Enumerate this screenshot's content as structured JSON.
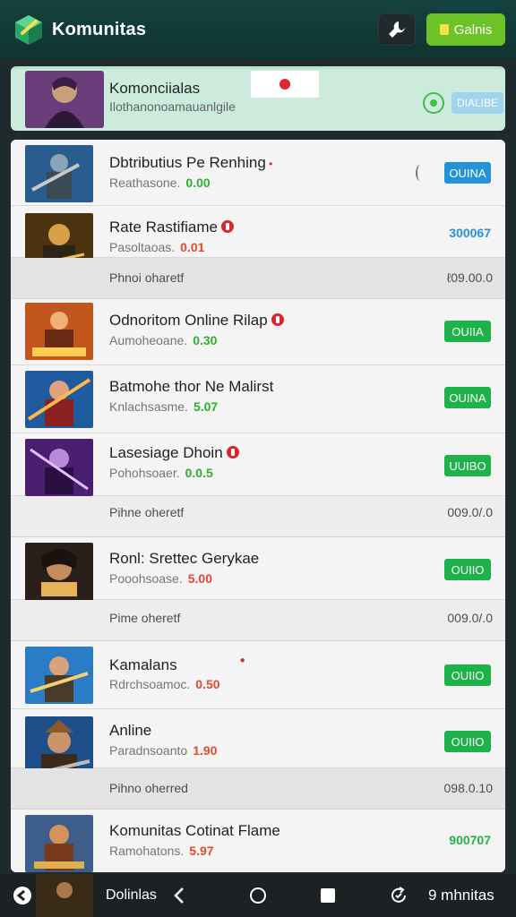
{
  "header": {
    "title": "Komunitas",
    "action_label": "Galnis",
    "logo_icon": "cube-logo-icon",
    "tool_icon": "wrench-icon"
  },
  "featured": {
    "title": "Komonciialas",
    "subtitle": "Ilothanonoamauanlgile",
    "tag_label": "DIALIBE"
  },
  "rows": [
    {
      "title": "Dbtributius Pe Renhing",
      "sub_label": "Reathasone.",
      "sub_value": "0.00",
      "sub_color": "#2fae2f",
      "action": "OUINA",
      "action_style": "blue"
    },
    {
      "title": "Rate Rastifiame",
      "sub_label": "Pasoltaoas.",
      "sub_value": "0.01",
      "sub_color": "#e24b2d",
      "action_text": "300067",
      "action_color": "#2592d8"
    },
    {
      "title": "Odnoritom Online Rilap",
      "sub_label": "Aumoheoane.",
      "sub_value": "0.30",
      "sub_color": "#2fae2f",
      "action": "OUIIA",
      "action_style": "green"
    },
    {
      "title": "Batmohe thor Ne Malirst",
      "sub_label": "Knlachsasme.",
      "sub_value": "5.07",
      "sub_color": "#2fae2f",
      "action": "OUINA",
      "action_style": "green"
    },
    {
      "title": "Lasesiage Dhoin",
      "sub_label": "Pohohsoaer.",
      "sub_value": "0.0.5",
      "sub_color": "#2fae2f",
      "action": "UUIBO",
      "action_style": "green"
    },
    {
      "title": "Ronl: Srettec Gerykae",
      "sub_label": "Pooohsoase.",
      "sub_value": "5.00",
      "sub_color": "#e2472d",
      "action": "OUIIO",
      "action_style": "green"
    },
    {
      "title": "Kamalans",
      "sub_label": "Rdrchsoamoc.",
      "sub_value": "0.50",
      "sub_color": "#e24b2d",
      "action": "OUIIO",
      "action_style": "green"
    },
    {
      "title": "Anline",
      "sub_label": "Paradnsoanto",
      "sub_value": "1.90",
      "sub_color": "#e24b2d",
      "action": "OUIIO",
      "action_style": "green"
    },
    {
      "title": "Komunitas Cotinat Flame",
      "sub_label": "Ramohatons.",
      "sub_value": "5.97",
      "sub_color": "#e24b2d",
      "action_text": "900707",
      "action_color": "#1fb24a"
    }
  ],
  "footers": [
    {
      "label": "Phnoi oharetf",
      "num": "ℓ09.00.0"
    },
    {
      "label": "Pihne oheretf",
      "num": "009.0/.0"
    },
    {
      "label": "Pime oheretf",
      "num": "009.0/.0"
    },
    {
      "label": "Pihno oherred",
      "num": "098.0.10"
    }
  ],
  "bottombar": {
    "left_label": "Dolinlas",
    "right_label": "9 mhnitas",
    "back_icon": "back-icon",
    "home_icon": "home-circle-icon",
    "recents_icon": "square-icon",
    "refresh_icon": "refresh-icon"
  },
  "colors": {
    "header_bg": "#15423f",
    "accent_green": "#6cc226",
    "button_green": "#1fb24a",
    "button_blue": "#2592d8"
  }
}
